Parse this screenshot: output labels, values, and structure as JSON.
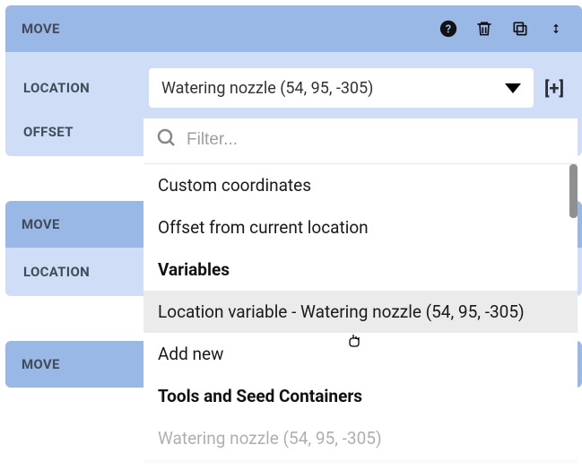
{
  "cards": [
    {
      "title": "MOVE",
      "rows": {
        "location_label": "LOCATION",
        "location_value": "Watering nozzle (54, 95, -305)",
        "offset_label": "OFFSET"
      }
    },
    {
      "title": "MOVE",
      "rows": {
        "location_label": "LOCATION"
      }
    },
    {
      "title": "MOVE"
    }
  ],
  "add_label": "[+]",
  "dropdown": {
    "filter_placeholder": "Filter...",
    "items": [
      {
        "type": "item",
        "label": "Custom coordinates"
      },
      {
        "type": "item",
        "label": "Offset from current location"
      },
      {
        "type": "heading",
        "label": "Variables"
      },
      {
        "type": "item",
        "label": "Location variable - Watering nozzle (54, 95, -305)",
        "highlight": true
      },
      {
        "type": "item",
        "label": "Add new"
      },
      {
        "type": "heading",
        "label": "Tools and Seed Containers"
      },
      {
        "type": "item",
        "label": "Watering nozzle (54, 95, -305)"
      }
    ]
  }
}
